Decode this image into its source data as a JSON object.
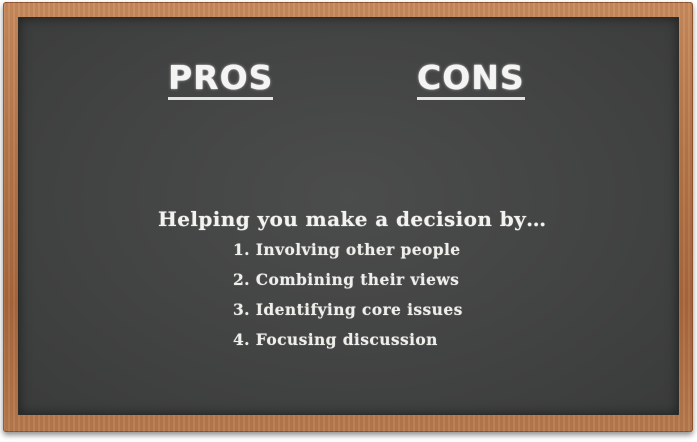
{
  "board": {
    "headings": {
      "pros": "PROS",
      "cons": "CONS"
    },
    "intro": "Helping you make a decision by…",
    "items": [
      "1. Involving other people",
      "2. Combining their views",
      "3. Identifying core issues",
      "4. Focusing discussion"
    ]
  },
  "colors": {
    "frame_wood": "#b6774a",
    "board_slate": "#424343",
    "chalk": "#f4f4f2"
  }
}
